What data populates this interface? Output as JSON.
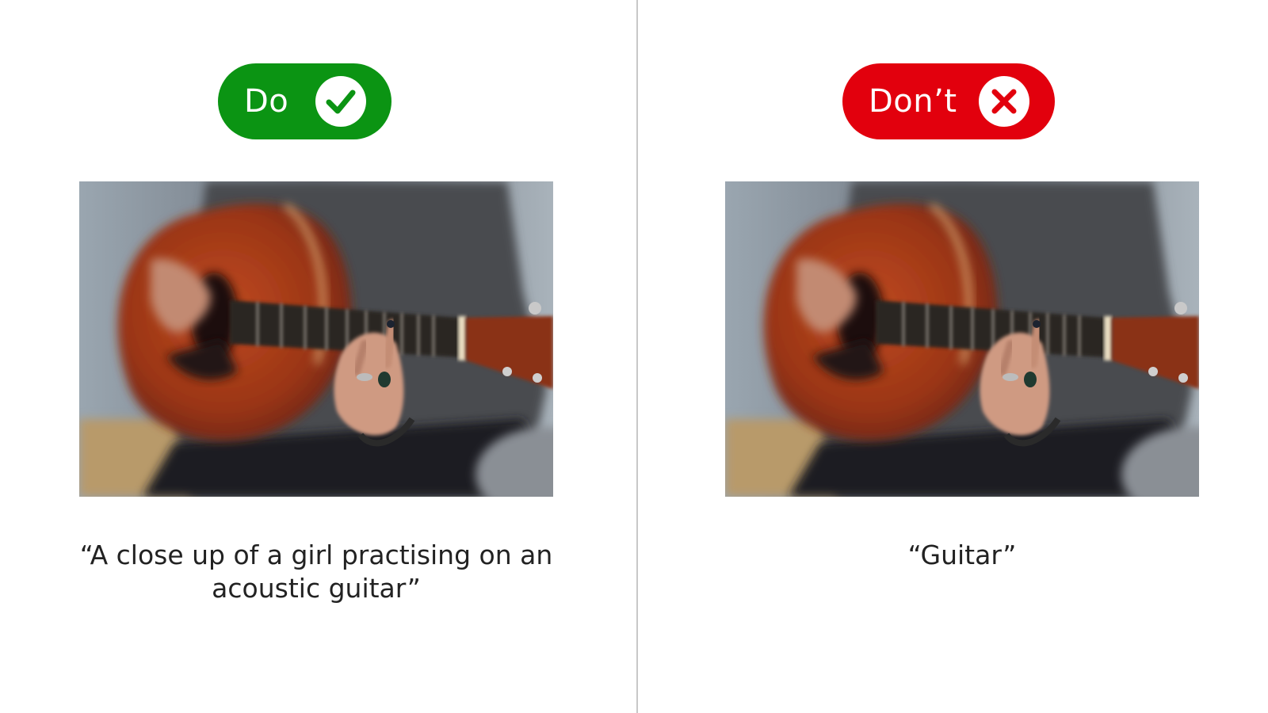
{
  "do_panel": {
    "label": "Do",
    "accent_color": "#0b9413",
    "icon": "check-icon",
    "caption": "“A close up of a girl practising on an acoustic guitar”"
  },
  "dont_panel": {
    "label": "Don’t",
    "accent_color": "#e2000d",
    "icon": "cross-icon",
    "caption": "“Guitar”"
  },
  "photo_subject": "guitar-photo"
}
